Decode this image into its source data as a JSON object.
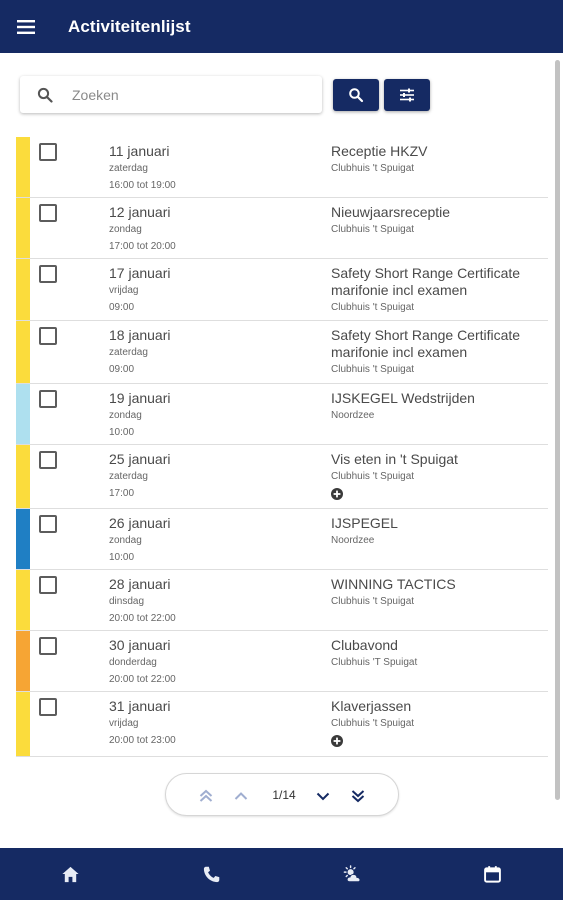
{
  "header": {
    "title": "Activiteitenlijst",
    "menu_icon": "menu-icon"
  },
  "search": {
    "placeholder": "Zoeken",
    "value": "",
    "search_icon": "search-icon",
    "filter_icon": "tune-icon"
  },
  "colors": {
    "primary": "#152a63",
    "yellow": "#fbdc3c",
    "light_blue": "#aee0ef",
    "blue": "#1f7fc4",
    "orange": "#f6a534"
  },
  "activities": [
    {
      "date": "11 januari",
      "day": "zaterdag",
      "time": "16:00 tot 19:00",
      "title": "Receptie HKZV",
      "location": "Clubhuis 't Spuigat",
      "color": "#fbdc3c",
      "has_plus": false
    },
    {
      "date": "12 januari",
      "day": "zondag",
      "time": "17:00 tot 20:00",
      "title": "Nieuwjaarsreceptie",
      "location": "Clubhuis 't Spuigat",
      "color": "#fbdc3c",
      "has_plus": false
    },
    {
      "date": "17 januari",
      "day": "vrijdag",
      "time": "09:00",
      "title": "Safety Short Range Certificate marifonie incl examen",
      "location": "Clubhuis 't Spuigat",
      "color": "#fbdc3c",
      "has_plus": false
    },
    {
      "date": "18 januari",
      "day": "zaterdag",
      "time": "09:00",
      "title": "Safety Short Range Certificate marifonie incl examen",
      "location": "Clubhuis 't Spuigat",
      "color": "#fbdc3c",
      "has_plus": false
    },
    {
      "date": "19 januari",
      "day": "zondag",
      "time": "10:00",
      "title": "IJSKEGEL Wedstrijden",
      "location": "Noordzee",
      "color": "#aee0ef",
      "has_plus": false
    },
    {
      "date": "25 januari",
      "day": "zaterdag",
      "time": "17:00",
      "title": "Vis eten in 't Spuigat",
      "location": "Clubhuis 't Spuigat",
      "color": "#fbdc3c",
      "has_plus": true
    },
    {
      "date": "26 januari",
      "day": "zondag",
      "time": "10:00",
      "title": "IJSPEGEL",
      "location": "Noordzee",
      "color": "#1f7fc4",
      "has_plus": false
    },
    {
      "date": "28 januari",
      "day": "dinsdag",
      "time": "20:00 tot 22:00",
      "title": "WINNING TACTICS",
      "location": "Clubhuis 't Spuigat",
      "color": "#fbdc3c",
      "has_plus": false
    },
    {
      "date": "30 januari",
      "day": "donderdag",
      "time": "20:00 tot 22:00",
      "title": "Clubavond",
      "location": "Clubhuis 'T Spuigat",
      "color": "#f6a534",
      "has_plus": false
    },
    {
      "date": "31 januari",
      "day": "vrijdag",
      "time": "20:00 tot 23:00",
      "title": "Klaverjassen",
      "location": "Clubhuis 't Spuigat",
      "color": "#fbdc3c",
      "has_plus": true
    }
  ],
  "pagination": {
    "page_info": "1/14",
    "first_icon": "double-chevron-up-icon",
    "prev_icon": "chevron-up-icon",
    "next_icon": "chevron-down-icon",
    "last_icon": "double-chevron-down-icon"
  },
  "bottom_nav": [
    {
      "icon": "home-icon"
    },
    {
      "icon": "phone-icon"
    },
    {
      "icon": "weather-icon"
    },
    {
      "icon": "calendar-icon"
    }
  ]
}
